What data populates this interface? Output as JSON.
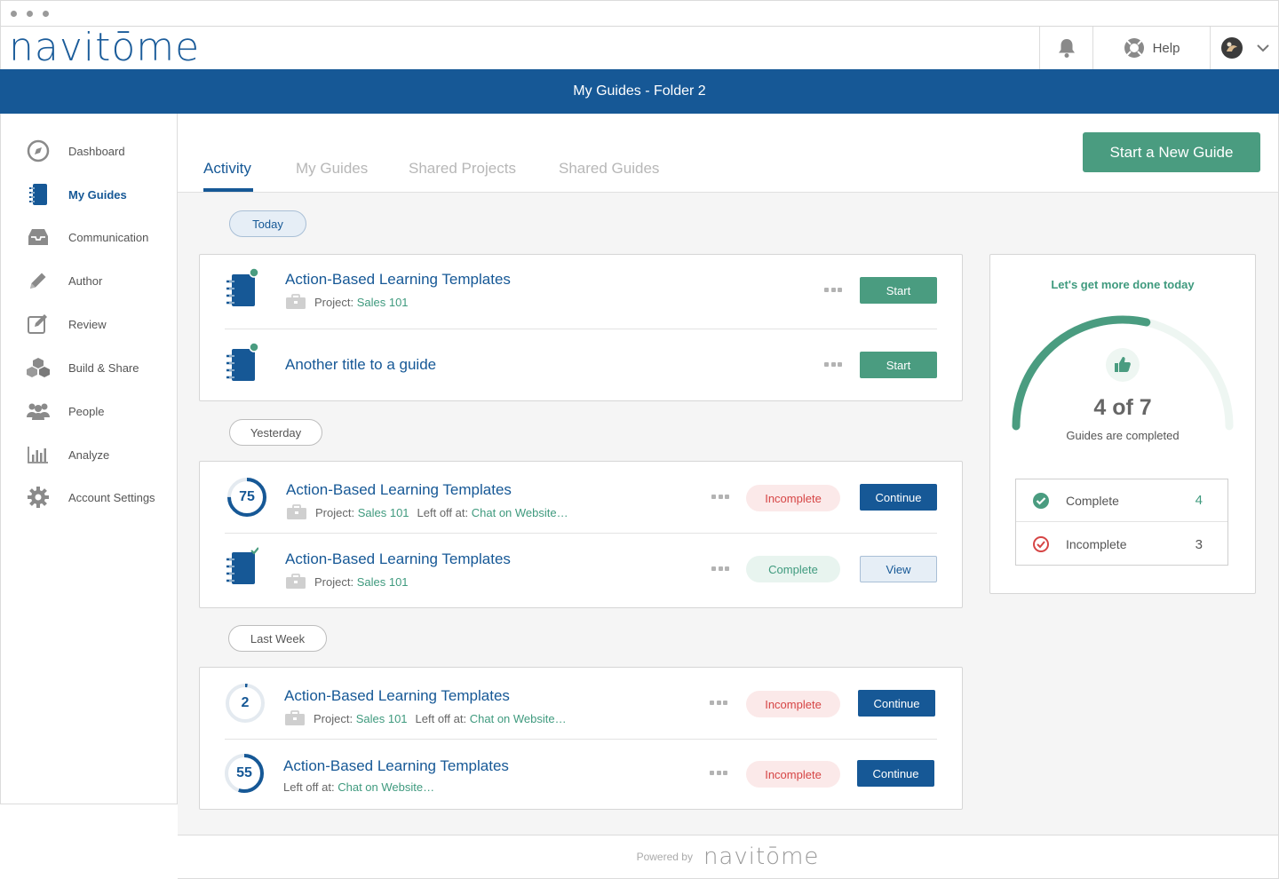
{
  "app": {
    "logo_text": "navitōme",
    "page_title": "My Guides - Folder 2",
    "help_label": "Help"
  },
  "sidebar": {
    "items": [
      {
        "label": "Dashboard",
        "icon": "compass-icon"
      },
      {
        "label": "My Guides",
        "icon": "notebook-icon",
        "active": true
      },
      {
        "label": "Communication",
        "icon": "inbox-icon"
      },
      {
        "label": "Author",
        "icon": "pencil-icon"
      },
      {
        "label": "Review",
        "icon": "edit-square-icon"
      },
      {
        "label": "Build & Share",
        "icon": "boxes-icon"
      },
      {
        "label": "People",
        "icon": "people-icon"
      },
      {
        "label": "Analyze",
        "icon": "bar-chart-icon"
      },
      {
        "label": "Account Settings",
        "icon": "gear-icon"
      }
    ]
  },
  "tabs": [
    "Activity",
    "My Guides",
    "Shared Projects",
    "Shared Guides"
  ],
  "new_guide_label": "Start a New Guide",
  "groups": {
    "today": {
      "label": "Today",
      "items": [
        {
          "title": "Action-Based Learning Templates",
          "project_label": "Project:",
          "project": "Sales 101",
          "action": "Start"
        },
        {
          "title": "Another title to a guide",
          "action": "Start"
        }
      ]
    },
    "yesterday": {
      "label": "Yesterday",
      "items": [
        {
          "progress": "75",
          "progress_value": 0.75,
          "title": "Action-Based Learning Templates",
          "project_label": "Project:",
          "project": "Sales 101",
          "left_off_label": "Left off at:",
          "left_off": "Chat on Website…",
          "status": "Incomplete",
          "action": "Continue"
        },
        {
          "title": "Action-Based Learning Templates",
          "project_label": "Project:",
          "project": "Sales 101",
          "status": "Complete",
          "action": "View"
        }
      ]
    },
    "last_week": {
      "label": "Last Week",
      "items": [
        {
          "progress": "2",
          "progress_value": 0.02,
          "title": "Action-Based Learning Templates",
          "project_label": "Project:",
          "project": "Sales 101",
          "left_off_label": "Left off at:",
          "left_off": "Chat on Website…",
          "status": "Incomplete",
          "action": "Continue"
        },
        {
          "progress": "55",
          "progress_value": 0.55,
          "title": "Action-Based Learning Templates",
          "left_off_label": "Left off at:",
          "left_off": "Chat on Website…",
          "status": "Incomplete",
          "action": "Continue"
        }
      ]
    }
  },
  "stats": {
    "heading": "Let's get more done today",
    "count_text": "4 of 7",
    "sub_text": "Guides are completed",
    "completed": 4,
    "total": 7,
    "complete_label": "Complete",
    "complete_value": "4",
    "incomplete_label": "Incomplete",
    "incomplete_value": "3"
  },
  "footer": {
    "powered_by": "Powered by",
    "logo_text": "navitōme"
  },
  "colors": {
    "brand_blue": "#165896",
    "green": "#4a9c80",
    "red": "#d64545"
  }
}
